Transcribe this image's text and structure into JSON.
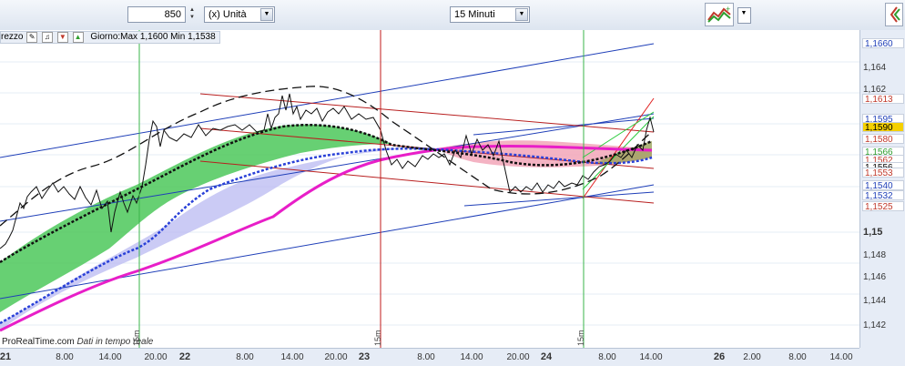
{
  "toolbar": {
    "quantity_value": "850",
    "unit_label": "(x) Unità",
    "timeframe_label": "15 Minuti"
  },
  "info": {
    "instrument_partial": "rezzo",
    "day_range": "Giorno:Max 1,1600 Min 1,1538"
  },
  "watermark": {
    "brand": "ProRealTime.com",
    "status": "Dati in tempo reale"
  },
  "y_axis": {
    "labels": [
      {
        "text": "1,164",
        "bold": false
      },
      {
        "text": "1,162",
        "bold": false
      },
      {
        "text": "1,15",
        "bold": true
      },
      {
        "text": "1,148",
        "bold": false
      },
      {
        "text": "1,146",
        "bold": false
      },
      {
        "text": "1,144",
        "bold": false
      },
      {
        "text": "1,142",
        "bold": false
      }
    ],
    "tags": [
      {
        "text": "1,1660",
        "color": "#1f3fb8",
        "bg": "#ffffff"
      },
      {
        "text": "1,1613",
        "color": "#c0392b",
        "bg": "#ffffff"
      },
      {
        "text": "1,1595",
        "color": "#1f3fb8",
        "bg": "#ffffff"
      },
      {
        "text": "1,1590",
        "color": "#000000",
        "bg": "#f5d000"
      },
      {
        "text": "1,1580",
        "color": "#c0392b",
        "bg": "#ffffff"
      },
      {
        "text": "1,1566",
        "color": "#2e9e2e",
        "bg": "#ffffff"
      },
      {
        "text": "1,1562",
        "color": "#c0392b",
        "bg": "#ffffff"
      },
      {
        "text": "1,1556",
        "color": "#000000",
        "bg": "#ffffff"
      },
      {
        "text": "1,1553",
        "color": "#c0392b",
        "bg": "#ffffff"
      },
      {
        "text": "1,1540",
        "color": "#1f3fb8",
        "bg": "#ffffff"
      },
      {
        "text": "1,1532",
        "color": "#1f3fb8",
        "bg": "#ffffff"
      },
      {
        "text": "1,1525",
        "color": "#c0392b",
        "bg": "#ffffff"
      }
    ]
  },
  "x_axis": {
    "labels": [
      {
        "text": "21",
        "day": true
      },
      {
        "text": "8.00",
        "day": false
      },
      {
        "text": "14.00",
        "day": false
      },
      {
        "text": "20.00",
        "day": false
      },
      {
        "text": "22",
        "day": true
      },
      {
        "text": "8.00",
        "day": false
      },
      {
        "text": "14.00",
        "day": false
      },
      {
        "text": "20.00",
        "day": false
      },
      {
        "text": "23",
        "day": true
      },
      {
        "text": "8.00",
        "day": false
      },
      {
        "text": "14.00",
        "day": false
      },
      {
        "text": "20.00",
        "day": false
      },
      {
        "text": "24",
        "day": true
      },
      {
        "text": "8.00",
        "day": false
      },
      {
        "text": "14.00",
        "day": false
      },
      {
        "text": "26",
        "day": true
      },
      {
        "text": "2.00",
        "day": false
      },
      {
        "text": "8.00",
        "day": false
      },
      {
        "text": "14.00",
        "day": false
      }
    ]
  },
  "cursor_tags": [
    "15m",
    "15m",
    "15m"
  ],
  "colors": {
    "green_fill": "#4cc85a",
    "blue_fill": "#b9b9f2",
    "magenta_line": "#e81ec8",
    "red_fill": "#f2a6b8",
    "trend_blue": "#1f3fb8",
    "trend_red": "#b81f1f"
  }
}
